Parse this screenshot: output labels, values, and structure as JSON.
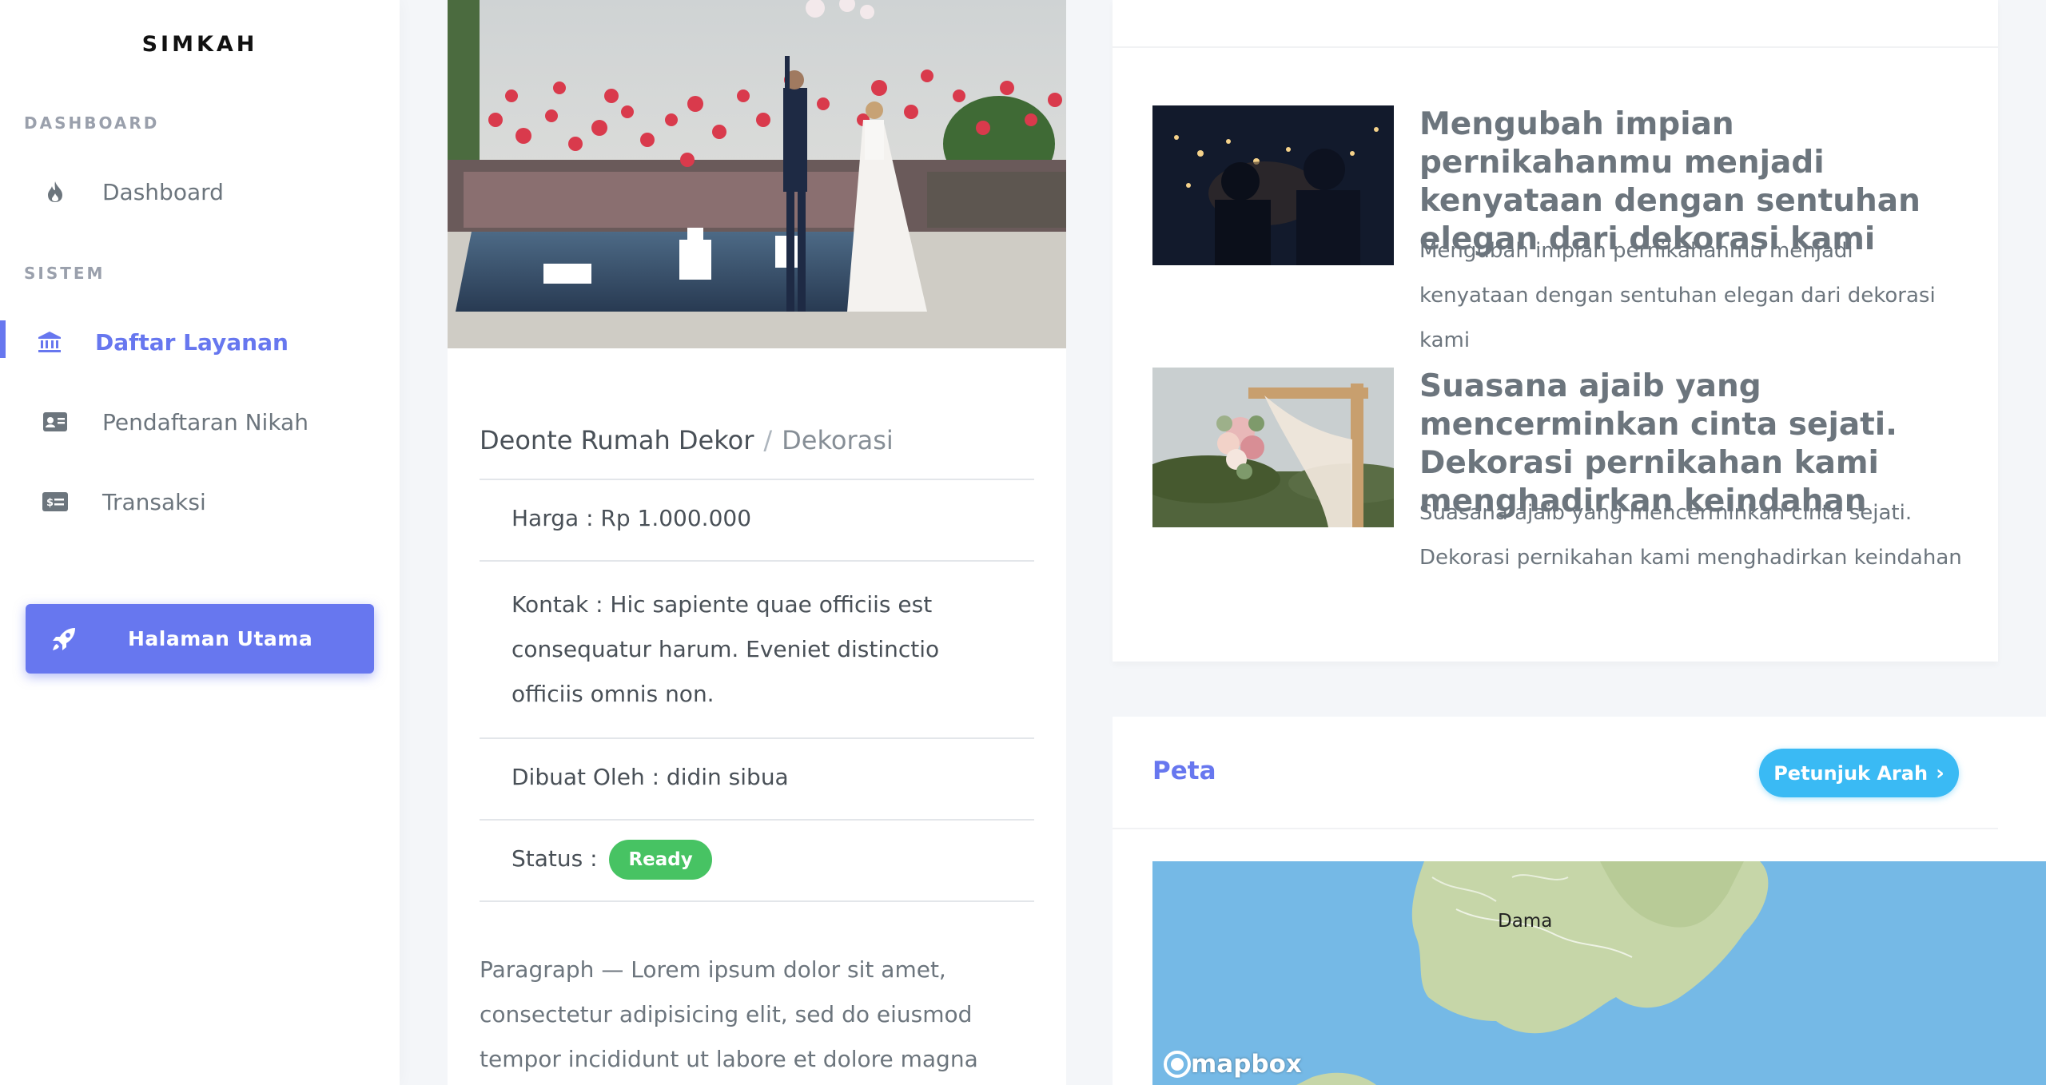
{
  "app": {
    "brand": "SIMKAH"
  },
  "sidebar": {
    "sections": [
      {
        "header": "DASHBOARD"
      },
      {
        "header": "SISTEM"
      }
    ],
    "items": [
      {
        "label": "Dashboard",
        "icon": "fire-icon",
        "active": false
      },
      {
        "label": "Daftar Layanan",
        "icon": "bank-icon",
        "active": true
      },
      {
        "label": "Pendaftaran Nikah",
        "icon": "id-card-icon",
        "active": false
      },
      {
        "label": "Transaksi",
        "icon": "money-check-icon",
        "active": false
      }
    ],
    "home_button": {
      "label": "Halaman Utama",
      "icon": "rocket-icon"
    }
  },
  "detail": {
    "vendor": "Deonte Rumah Dekor",
    "separator": "/",
    "category": "Dekorasi",
    "price": "Harga : Rp 1.000.000",
    "contact": "Kontak : Hic sapiente quae officiis est consequatur harum. Eveniet distinctio officiis omnis non.",
    "created_by": "Dibuat Oleh : didin sibua",
    "status_label": "Status :",
    "status_value": "Ready",
    "paragraph": "Paragraph — Lorem ipsum dolor sit amet, consectetur adipisicing elit, sed do eiusmod tempor incididunt ut labore et dolore magna aliqua. Ut enim ad minim"
  },
  "articles": [
    {
      "title": "Mengubah impian pernikahanmu menjadi kenyataan dengan sentuhan elegan dari dekorasi kami",
      "description": "Mengubah impian pernikahanmu menjadi kenyataan dengan sentuhan elegan dari dekorasi kami"
    },
    {
      "title": "Suasana ajaib yang mencerminkan cinta sejati. Dekorasi pernikahan kami menghadirkan keindahan",
      "description": "Suasana ajaib yang mencerminkan cinta sejati. Dekorasi pernikahan kami menghadirkan keindahan"
    }
  ],
  "map_section": {
    "title": "Peta",
    "button_label": "Petunjuk Arah",
    "place_label": "Dama",
    "attribution": "mapbox"
  },
  "colors": {
    "primary": "#6777ef",
    "info": "#3abaf4",
    "success": "#47c363",
    "background": "#f4f6f9"
  }
}
